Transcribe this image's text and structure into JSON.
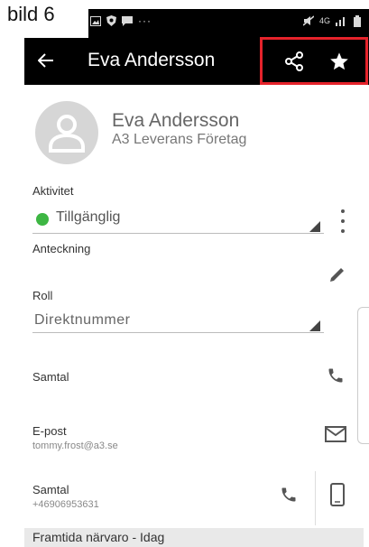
{
  "caption": "bild 6",
  "status_bar": {
    "left_icons": [
      "image-icon",
      "shield-icon",
      "chat-icon",
      "more-dots-icon"
    ],
    "network": "4G"
  },
  "toolbar": {
    "title": "Eva Andersson"
  },
  "profile": {
    "name": "Eva Andersson",
    "company": "A3 Leverans Företag"
  },
  "activity": {
    "label": "Aktivitet",
    "value": "Tillgänglig",
    "status_color": "#3db643"
  },
  "note": {
    "label": "Anteckning"
  },
  "role": {
    "label": "Roll",
    "value": "Direktnummer"
  },
  "call": {
    "label": "Samtal"
  },
  "email": {
    "label": "E-post",
    "value": "tommy.frost@a3.se"
  },
  "call2": {
    "label": "Samtal",
    "value": "+46906953631"
  },
  "future": {
    "label": "Framtida närvaro - Idag"
  },
  "colors": {
    "highlight": "#e5232b",
    "toolbar_bg": "#000000",
    "available": "#3db643"
  }
}
